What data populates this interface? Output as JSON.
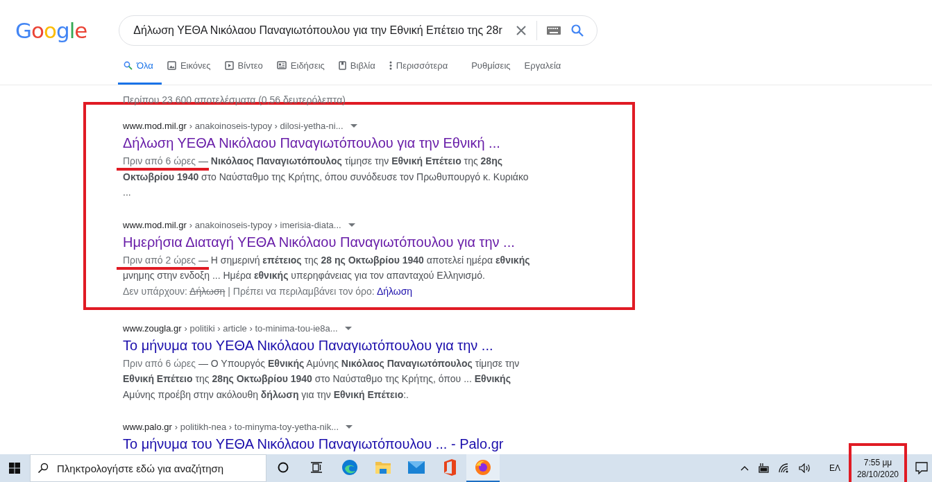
{
  "logo": "Google",
  "search": {
    "value": "Δήλωση ΥΕΘΑ Νικόλαου Παναγιωτόπουλου για την Εθνική Επέτειο της 28r"
  },
  "tabs": [
    {
      "label": "Όλα",
      "kind": "search",
      "selected": true
    },
    {
      "label": "Εικόνες",
      "kind": "image",
      "selected": false
    },
    {
      "label": "Βίντεο",
      "kind": "play",
      "selected": false
    },
    {
      "label": "Ειδήσεις",
      "kind": "news",
      "selected": false
    },
    {
      "label": "Βιβλία",
      "kind": "book",
      "selected": false
    },
    {
      "label": "Περισσότερα",
      "kind": "more",
      "selected": false
    },
    {
      "label": "Ρυθμίσεις",
      "kind": "plain",
      "selected": false
    },
    {
      "label": "Εργαλεία",
      "kind": "plain",
      "selected": false
    }
  ],
  "result_stats": "Περίπου 23.600 αποτελέσματα (0,56 δευτερόλεπτα)",
  "results": [
    {
      "site": "www.mod.mil.gr",
      "path": "› anakoinoseis-typoy › dilosi-yetha-ni...",
      "title": "Δήλωση ΥΕΘΑ Νικόλαου Παναγιωτόπουλου για την Εθνική ...",
      "visited": true,
      "highlighted": true,
      "date": "Πριν από 6 ώρες",
      "date_underlined": true,
      "snippet": "— **Νικόλαος Παναγιωτόπουλος** τίμησε την **Εθνική Επέτειο** της **28ης Οκτωβρίου 1940** στο Ναύσταθμο της Κρήτης, όπου συνόδευσε τον Πρωθυπουργό κ. Κυριάκο ..."
    },
    {
      "site": "www.mod.mil.gr",
      "path": "› anakoinoseis-typoy › imerisia-diata...",
      "title": "Ημερήσια Διαταγή ΥΕΘΑ Νικόλαου Παναγιωτόπουλου για την ...",
      "visited": true,
      "highlighted": true,
      "date": "Πριν από 2 ώρες",
      "date_underlined": true,
      "snippet": "— Η σημερινή **επέτειος** της **28 ης Οκτωβρίου 1940** αποτελεί ημέρα **εθνικής** μνημης στην ενδοξη ... Ημέρα **εθνικής** υπερηφάνειας για τον απανταχού Ελληνισμό.",
      "missing": {
        "label": "Δεν υπάρχουν:",
        "term": "Δήλωση",
        "include_label": "| Πρέπει να περιλαμβάνει τον όρο:",
        "include_link": "Δήλωση"
      }
    },
    {
      "site": "www.zougla.gr",
      "path": "› politiki › article › to-minima-tou-ie8a...",
      "title": "Το μήνυμα του ΥΕΘΑ Νικόλαου Παναγιωτόπουλου για την ...",
      "visited": false,
      "highlighted": false,
      "date": "Πριν από 6 ώρες",
      "date_underlined": false,
      "snippet": "— Ο Υπουργός **Εθνικής** Αμύνης **Νικόλαος Παναγιωτόπουλος** τίμησε την **Εθνική Επέτειο** της **28ης Οκτωβρίου 1940** στο Ναύσταθμο της Κρήτης, όπου ... **Εθνικής** Αμύνης προέβη στην ακόλουθη **δήλωση** για την **Εθνική Επέτειο**:."
    },
    {
      "site": "www.palo.gr",
      "path": "› politikh-nea › to-minyma-toy-yetha-nik...",
      "title": "Το μήνυμα του ΥΕΘΑ Νικόλαου Παναγιωτόπουλου ... - Palo.gr",
      "visited": false,
      "highlighted": false
    }
  ],
  "taskbar": {
    "search_placeholder": "Πληκτρολογήστε εδώ για αναζήτηση",
    "apps": [
      {
        "kind": "cortana",
        "active": false
      },
      {
        "kind": "taskview",
        "active": false
      },
      {
        "kind": "edge",
        "active": false
      },
      {
        "kind": "explorer",
        "active": false
      },
      {
        "kind": "mail",
        "active": false
      },
      {
        "kind": "office",
        "active": false
      },
      {
        "kind": "firefox",
        "active": true
      }
    ],
    "language": "ΕΛ",
    "time": "7:55 μμ",
    "date": "28/10/2020",
    "clock_highlighted": true
  }
}
